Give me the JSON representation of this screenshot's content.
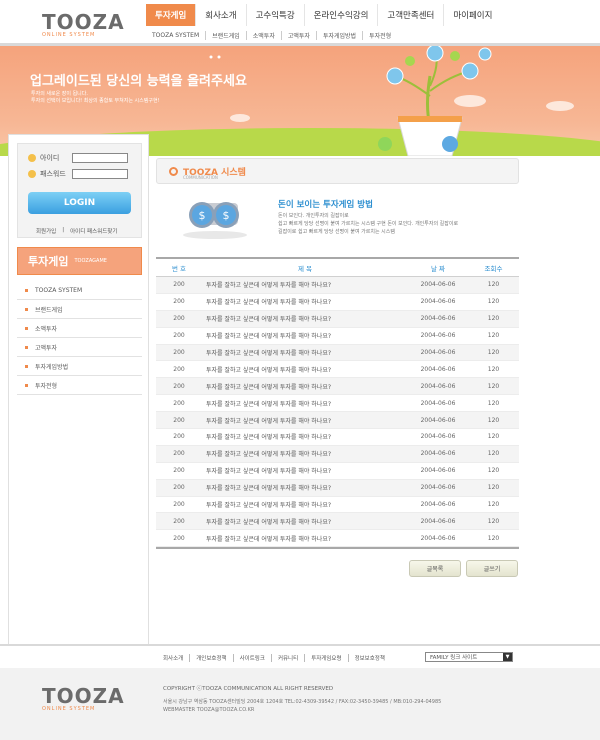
{
  "brand": {
    "logo": "TOOZA",
    "logo_sub": "ONLINE SYSTEM"
  },
  "gnb": [
    {
      "label": "투자게임",
      "active": true
    },
    {
      "label": "회사소개",
      "active": false
    },
    {
      "label": "고수익특강",
      "active": false
    },
    {
      "label": "온라인수익강의",
      "active": false
    },
    {
      "label": "고객만족센터",
      "active": false
    },
    {
      "label": "마이페이지",
      "active": false
    }
  ],
  "sub_gnb": [
    "TOOZA SYSTEM",
    "브랜드게임",
    "소액투자",
    "고액투자",
    "투자게임방법",
    "투자전형"
  ],
  "banner": {
    "title": "업그레이드된 당신의 능력을 올려주세요",
    "desc1": "투자의 새로운 장이 됩니다.",
    "desc2": "투자의 선택이 보입니다! 최상의 종합토 부쳐지는 시스템구현!"
  },
  "login": {
    "id_label": "아이디",
    "pw_label": "패스워드",
    "button": "LOGIN",
    "join": "회원가입",
    "find": "아이디 패스워드찾기"
  },
  "sidebar": {
    "title": "투자게임",
    "title_sub": "TOOZAGAME",
    "items": [
      "TOOZA SYSTEM",
      "브랜드게임",
      "소액투자",
      "고액투자",
      "투자게임방법",
      "투자전형"
    ]
  },
  "main": {
    "title": "TOOZA 시스템",
    "title_sub": "COMMUNICATION",
    "intro_title": "돈이 보이는 투자게임 방법",
    "intro_desc": [
      "돈이 보인다. 개인투자의 길잡이로",
      "쉽고 빠르게 당당 선명이 붙여 가르치는 시스템 구현 돈이 보인다. 개인투자의 길잡이로",
      "길잡이로 쉽고 빠르게 당당 선명이 붙여 가르치는 시스템"
    ]
  },
  "board": {
    "headers": {
      "num": "번 호",
      "subject": "제 목",
      "date": "날 짜",
      "hits": "조회수"
    },
    "rows": [
      {
        "num": "200",
        "subject": "투자를 잘하고 싶은데 어떻게 투자를 해야 하나요?",
        "date": "2004-06-06",
        "hits": "120"
      },
      {
        "num": "200",
        "subject": "투자를 잘하고 싶은데 어떻게 투자를 해야 하나요?",
        "date": "2004-06-06",
        "hits": "120"
      },
      {
        "num": "200",
        "subject": "투자를 잘하고 싶은데 어떻게 투자를 해야 하나요?",
        "date": "2004-06-06",
        "hits": "120"
      },
      {
        "num": "200",
        "subject": "투자를 잘하고 싶은데 어떻게 투자를 해야 하나요?",
        "date": "2004-06-06",
        "hits": "120"
      },
      {
        "num": "200",
        "subject": "투자를 잘하고 싶은데 어떻게 투자를 해야 하나요?",
        "date": "2004-06-06",
        "hits": "120"
      },
      {
        "num": "200",
        "subject": "투자를 잘하고 싶은데 어떻게 투자를 해야 하나요?",
        "date": "2004-06-06",
        "hits": "120"
      },
      {
        "num": "200",
        "subject": "투자를 잘하고 싶은데 어떻게 투자를 해야 하나요?",
        "date": "2004-06-06",
        "hits": "120"
      },
      {
        "num": "200",
        "subject": "투자를 잘하고 싶은데 어떻게 투자를 해야 하나요?",
        "date": "2004-06-06",
        "hits": "120"
      },
      {
        "num": "200",
        "subject": "투자를 잘하고 싶은데 어떻게 투자를 해야 하나요?",
        "date": "2004-06-06",
        "hits": "120"
      },
      {
        "num": "200",
        "subject": "투자를 잘하고 싶은데 어떻게 투자를 해야 하나요?",
        "date": "2004-06-06",
        "hits": "120"
      },
      {
        "num": "200",
        "subject": "투자를 잘하고 싶은데 어떻게 투자를 해야 하나요?",
        "date": "2004-06-06",
        "hits": "120"
      },
      {
        "num": "200",
        "subject": "투자를 잘하고 싶은데 어떻게 투자를 해야 하나요?",
        "date": "2004-06-06",
        "hits": "120"
      },
      {
        "num": "200",
        "subject": "투자를 잘하고 싶은데 어떻게 투자를 해야 하나요?",
        "date": "2004-06-06",
        "hits": "120"
      },
      {
        "num": "200",
        "subject": "투자를 잘하고 싶은데 어떻게 투자를 해야 하나요?",
        "date": "2004-06-06",
        "hits": "120"
      },
      {
        "num": "200",
        "subject": "투자를 잘하고 싶은데 어떻게 투자를 해야 하나요?",
        "date": "2004-06-06",
        "hits": "120"
      },
      {
        "num": "200",
        "subject": "투자를 잘하고 싶은데 어떻게 투자를 해야 하나요?",
        "date": "2004-06-06",
        "hits": "120"
      }
    ]
  },
  "buttons": {
    "list": "글목록",
    "write": "글쓰기"
  },
  "footer": {
    "links": [
      "회사소개",
      "개인보호정책",
      "사이트링크",
      "커뮤니티",
      "투자게임요령",
      "정보보호정책"
    ],
    "family": "FAMILY 링크 사이트",
    "copyright": "COPYRIGHT ⓒTOOZA COMMUNICATION ALL RIGHT RESERVED",
    "address": "서울시 강남구 역삼동 TOOZA센터빌딩 2004호 1204호 TEL:02-4309-39542 / FAX:02-3450-39485 / MB:010-294-04985",
    "webmaster": "WEBMASTER TOOZA@TOOZA.CO.KR"
  },
  "colors": {
    "accent": "#f08a4b",
    "link_blue": "#2d8fd0",
    "banner": "#f5a37c"
  }
}
